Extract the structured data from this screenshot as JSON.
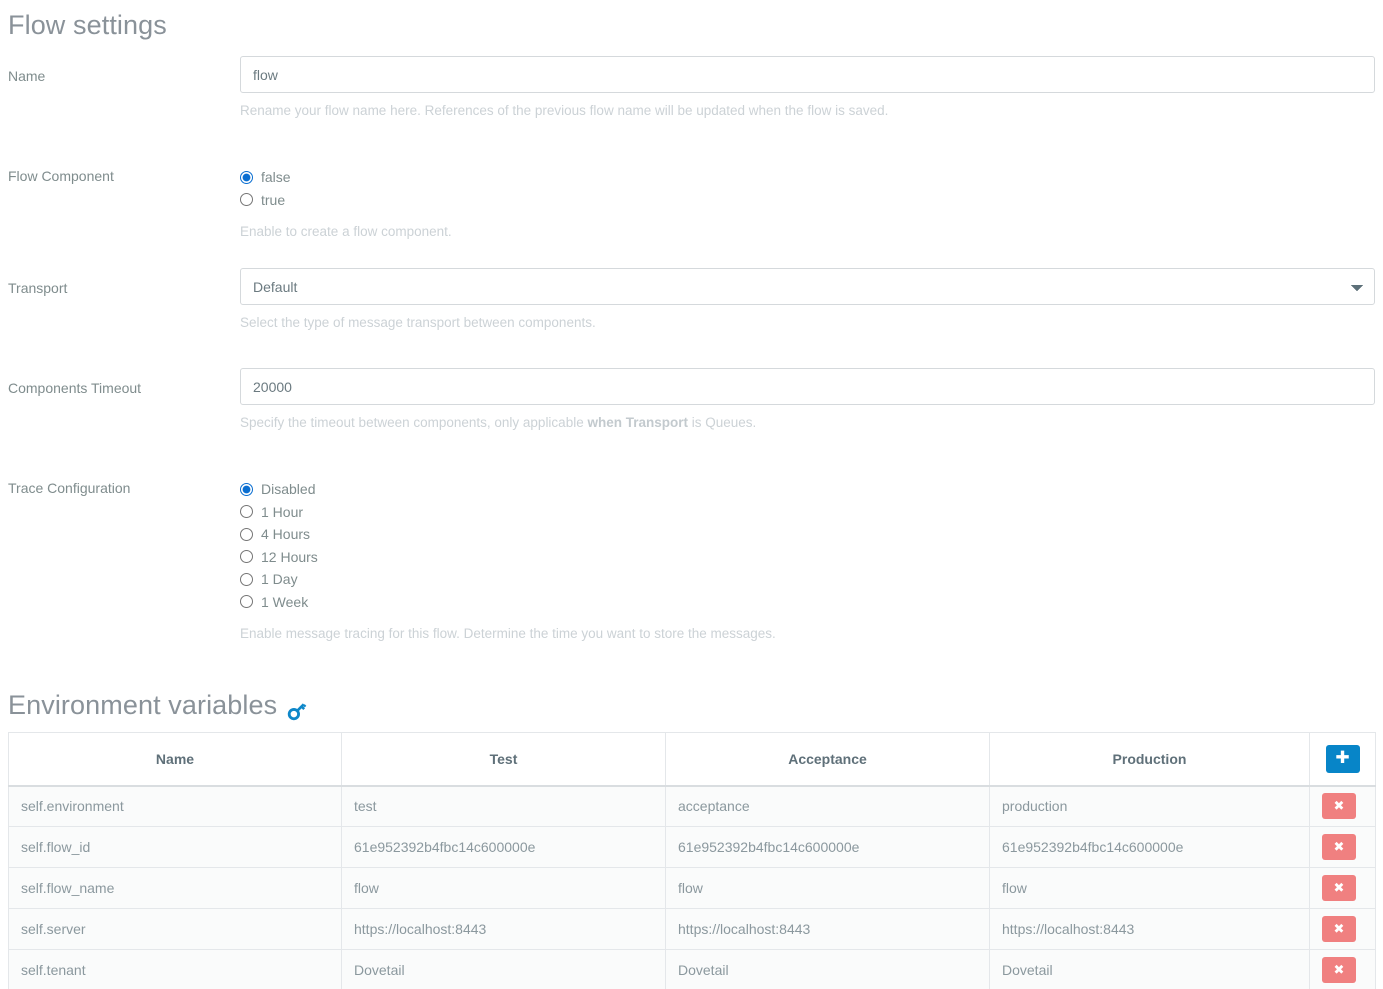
{
  "flow_settings": {
    "title": "Flow settings",
    "fields": {
      "name": {
        "label": "Name",
        "value": "flow",
        "placeholder": "",
        "help": "Rename your flow name here. References of the previous flow name will be updated when the flow is saved."
      },
      "flow_component": {
        "label": "Flow Component",
        "selected": "false",
        "options": [
          "false",
          "true"
        ],
        "help": "Enable to create a flow component."
      },
      "transport": {
        "label": "Transport",
        "value": "Default",
        "options": [
          "Default"
        ],
        "help": "Select the type of message transport between components."
      },
      "components_timeout": {
        "label": "Components Timeout",
        "value": "20000",
        "placeholder": "",
        "help_pre": "Specify the timeout between components, only applicable ",
        "help_bold": "when Transport",
        "help_post": " is Queues."
      },
      "trace_configuration": {
        "label": "Trace Configuration",
        "selected": "Disabled",
        "options": [
          "Disabled",
          "1 Hour",
          "4 Hours",
          "12 Hours",
          "1 Day",
          "1 Week"
        ],
        "help": "Enable message tracing for this flow. Determine the time you want to store the messages."
      }
    }
  },
  "environment_variables": {
    "title": "Environment variables",
    "icon": "key-icon",
    "add_label": "+",
    "delete_label": "✖",
    "columns": [
      "Name",
      "Test",
      "Acceptance",
      "Production"
    ],
    "rows": [
      {
        "name": "self.environment",
        "test": "test",
        "acceptance": "acceptance",
        "production": "production"
      },
      {
        "name": "self.flow_id",
        "test": "61e952392b4fbc14c600000e",
        "acceptance": "61e952392b4fbc14c600000e",
        "production": "61e952392b4fbc14c600000e"
      },
      {
        "name": "self.flow_name",
        "test": "flow",
        "acceptance": "flow",
        "production": "flow"
      },
      {
        "name": "self.server",
        "test": "https://localhost:8443",
        "acceptance": "https://localhost:8443",
        "production": "https://localhost:8443"
      },
      {
        "name": "self.tenant",
        "test": "Dovetail",
        "acceptance": "Dovetail",
        "production": "Dovetail"
      }
    ]
  },
  "colors": {
    "accent_blue": "#0785c8",
    "radio_blue": "#0a6ed1",
    "delete_red": "#f08080",
    "label_gray": "#7f8c8d",
    "help_gray": "#ccd2d6",
    "heading_gray": "#8a9299"
  }
}
